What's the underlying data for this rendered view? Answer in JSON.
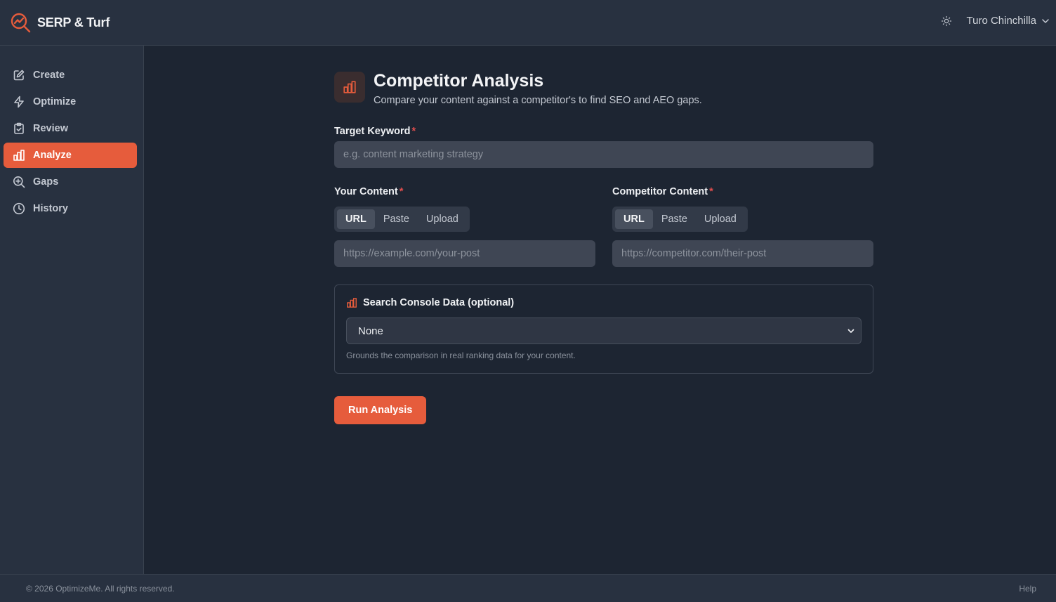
{
  "app": {
    "brand": "SERP & Turf"
  },
  "user": {
    "name": "Turo Chinchilla"
  },
  "sidebar": {
    "items": [
      {
        "label": "Create",
        "icon": "edit-icon",
        "active": false
      },
      {
        "label": "Optimize",
        "icon": "bolt-icon",
        "active": false
      },
      {
        "label": "Review",
        "icon": "clipboard-check-icon",
        "active": false
      },
      {
        "label": "Analyze",
        "icon": "bar-chart-icon",
        "active": true
      },
      {
        "label": "Gaps",
        "icon": "zoom-in-icon",
        "active": false
      },
      {
        "label": "History",
        "icon": "clock-icon",
        "active": false
      }
    ]
  },
  "page": {
    "title": "Competitor Analysis",
    "subtitle": "Compare your content against a competitor's to find SEO and AEO gaps."
  },
  "form": {
    "keyword": {
      "label": "Target Keyword",
      "required": "*",
      "placeholder": "e.g. content marketing strategy"
    },
    "your_content": {
      "label": "Your Content",
      "required": "*",
      "tabs": [
        "URL",
        "Paste",
        "Upload"
      ],
      "placeholder": "https://example.com/your-post"
    },
    "competitor_content": {
      "label": "Competitor Content",
      "required": "*",
      "tabs": [
        "URL",
        "Paste",
        "Upload"
      ],
      "placeholder": "https://competitor.com/their-post"
    },
    "search_console": {
      "title": "Search Console Data (optional)",
      "selected": "None",
      "hint": "Grounds the comparison in real ranking data for your content."
    },
    "submit_label": "Run Analysis"
  },
  "footer": {
    "copyright": "© 2026 OptimizeMe. All rights reserved.",
    "help": "Help"
  },
  "colors": {
    "accent": "#e65c3c",
    "background": "#1d2532",
    "panel": "#283140"
  }
}
